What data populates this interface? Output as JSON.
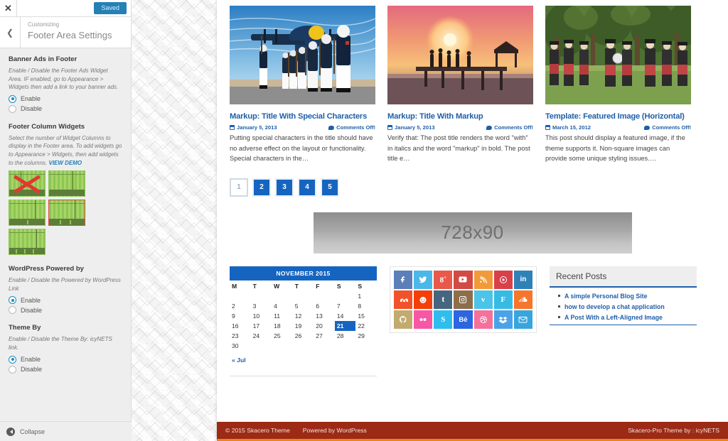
{
  "customizer": {
    "close_icon": "close-icon",
    "save_label": "Saved",
    "back_icon": "chevron-left-icon",
    "eyebrow": "Customizing",
    "title": "Footer Area Settings",
    "collapse_label": "Collapse",
    "sections": [
      {
        "title": "Banner Ads in Footer",
        "description": "Enable / Disable the Footer Ads Widget Area. IF enabled, go to Appearance > Widgets then add a link to your banner ads.",
        "options": [
          {
            "label": "Enable",
            "selected": true
          },
          {
            "label": "Disable",
            "selected": false
          }
        ]
      },
      {
        "title": "Footer Column Widgets",
        "description": "Select the number of Widget Columns to display in the Footer area. To add widgets go to Appearance > Widgets, then add widgets to the columns.",
        "link_label": "VIEW DEMO",
        "thumbnails": [
          {
            "name": "columns-1",
            "selected": false,
            "broken": true
          },
          {
            "name": "columns-2",
            "selected": false,
            "broken": false
          },
          {
            "name": "columns-3",
            "selected": false,
            "broken": false
          },
          {
            "name": "columns-4",
            "selected": true,
            "broken": false
          },
          {
            "name": "columns-5",
            "selected": false,
            "broken": false
          }
        ]
      },
      {
        "title": "WordPress Powered by",
        "description": "Enable / Disable the Powered by WordPress Link",
        "options": [
          {
            "label": "Enable",
            "selected": true
          },
          {
            "label": "Disable",
            "selected": false
          }
        ]
      },
      {
        "title": "Theme By",
        "description": "Enable / Disable the Theme By: icyNETS link.",
        "options": [
          {
            "label": "Enable",
            "selected": true
          },
          {
            "label": "Disable",
            "selected": false
          }
        ]
      }
    ]
  },
  "preview": {
    "posts": [
      {
        "title": "Markup: Title With Special Characters",
        "date": "January 5, 2013",
        "comments": "Comments Off!",
        "excerpt": "Putting special characters in the title should have no adverse effect on the layout or functionality. Special characters in the…",
        "image": "marines-honor-guard-airplane"
      },
      {
        "title": "Markup: Title With Markup",
        "date": "January 5, 2013",
        "comments": "Comments Off!",
        "excerpt": "Verify that: The post title renders the word \"with\" in italics and the word \"markup\" in bold. The post title e…",
        "image": "sunset-pier-silhouette"
      },
      {
        "title": "Template: Featured Image (Horizontal)",
        "date": "March 15, 2012",
        "comments": "Comments Off!",
        "excerpt": "This post should display a featured image, if the theme supports it. Non-square images can provide some unique styling issues.…",
        "image": "bagpipe-band-kilts-park"
      }
    ],
    "pagination": [
      {
        "label": "1",
        "active": true
      },
      {
        "label": "2",
        "active": false
      },
      {
        "label": "3",
        "active": false
      },
      {
        "label": "4",
        "active": false
      },
      {
        "label": "5",
        "active": false
      }
    ],
    "banner_label": "728x90",
    "calendar": {
      "caption": "NOVEMBER 2015",
      "weekdays": [
        "M",
        "T",
        "W",
        "T",
        "F",
        "S",
        "S"
      ],
      "weeks": [
        [
          "",
          "",
          "",
          "",
          "",
          "",
          "1"
        ],
        [
          "2",
          "3",
          "4",
          "5",
          "6",
          "7",
          "8"
        ],
        [
          "9",
          "10",
          "11",
          "12",
          "13",
          "14",
          "15"
        ],
        [
          "16",
          "17",
          "18",
          "19",
          "20",
          "21",
          "22"
        ],
        [
          "23",
          "24",
          "25",
          "26",
          "27",
          "28",
          "29"
        ],
        [
          "30",
          "",
          "",
          "",
          "",
          "",
          ""
        ]
      ],
      "today": "21",
      "prev_label": "« Jul"
    },
    "socials": [
      {
        "name": "facebook",
        "glyph": "f",
        "color": "#5c7fba"
      },
      {
        "name": "twitter",
        "glyph": "t",
        "color": "#4cb8ea"
      },
      {
        "name": "google-plus",
        "glyph": "g",
        "color": "#e8594a"
      },
      {
        "name": "youtube",
        "glyph": "y",
        "color": "#d24a44"
      },
      {
        "name": "rss",
        "glyph": "r",
        "color": "#f29a38"
      },
      {
        "name": "pinterest",
        "glyph": "p",
        "color": "#d8404a"
      },
      {
        "name": "linkedin",
        "glyph": "in",
        "color": "#2f82b8"
      },
      {
        "name": "stumbleupon",
        "glyph": "s",
        "color": "#f2522a"
      },
      {
        "name": "reddit",
        "glyph": "o",
        "color": "#f53f0a"
      },
      {
        "name": "tumblr",
        "glyph": "t",
        "color": "#46667f"
      },
      {
        "name": "instagram",
        "glyph": "i",
        "color": "#8d6e4b"
      },
      {
        "name": "vimeo",
        "glyph": "v",
        "color": "#4cc3e8"
      },
      {
        "name": "foursquare",
        "glyph": "F",
        "color": "#37bbe4"
      },
      {
        "name": "soundcloud",
        "glyph": "c",
        "color": "#f6762c"
      },
      {
        "name": "github",
        "glyph": "G",
        "color": "#c2ab6e"
      },
      {
        "name": "flickr",
        "glyph": "..",
        "color": "#f857a6"
      },
      {
        "name": "skype",
        "glyph": "S",
        "color": "#2fbdee"
      },
      {
        "name": "behance",
        "glyph": "Bē",
        "color": "#2c66e0"
      },
      {
        "name": "dribbble",
        "glyph": "d",
        "color": "#f5709b"
      },
      {
        "name": "dropbox",
        "glyph": "D",
        "color": "#4aa3e8"
      },
      {
        "name": "email",
        "glyph": "M",
        "color": "#38a5dd"
      }
    ],
    "recent": {
      "heading": "Recent Posts",
      "items": [
        "A simple Personal Blog Site",
        "how to develop a chat application",
        "A Post With a Left-Aligned Image"
      ]
    },
    "footer": {
      "copyright": "© 2015 Skacero Theme",
      "powered": "Powered by WordPress",
      "credit": "Skacero-Pro Theme by : icyNETS"
    }
  }
}
